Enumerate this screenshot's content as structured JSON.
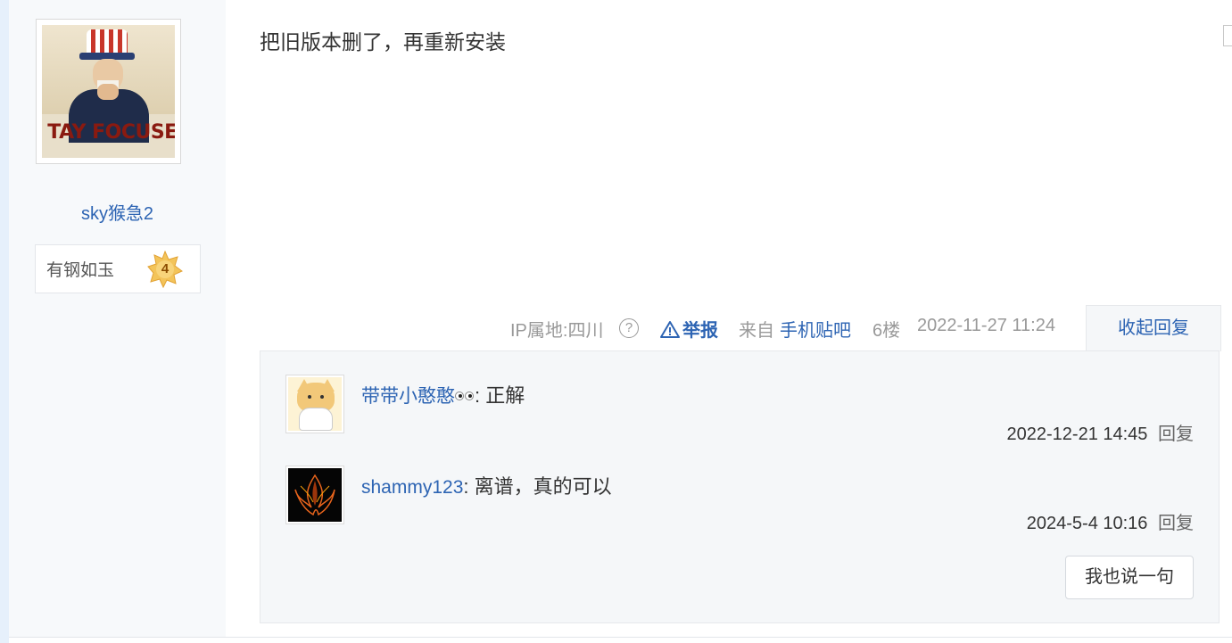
{
  "author": {
    "avatar_text": "TAY FOCUSE",
    "username": "sky猴急2",
    "level_name": "有钢如玉",
    "level_num": "4"
  },
  "post": {
    "content": "把旧版本删了，再重新安装"
  },
  "meta": {
    "ip": "IP属地:四川",
    "help_icon": "?",
    "report": "举报",
    "from_prefix": "来自",
    "from_app": "手机贴吧",
    "floor": "6楼",
    "time": "2022-11-27 11:24",
    "collapse": "收起回复"
  },
  "replies": [
    {
      "user": "带带小憨憨",
      "sep": ": ",
      "text": "正解",
      "time": "2022-12-21 14:45",
      "reply_label": "回复"
    },
    {
      "user": "shammy123",
      "sep": ": ",
      "text": "离谱，真的可以",
      "time": "2024-5-4 10:16",
      "reply_label": "回复"
    }
  ],
  "say_button": "我也说一句",
  "colors": {
    "link": "#2d64b3",
    "muted": "#999999",
    "reply_bg": "#f5f7f9",
    "author_bg": "#f7f9fb"
  }
}
